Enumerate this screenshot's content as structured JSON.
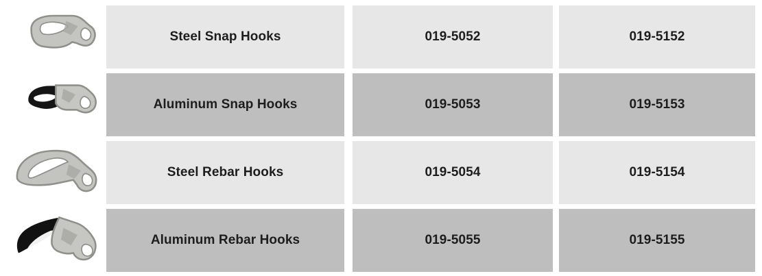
{
  "table": {
    "rows": [
      {
        "product": "Steel Snap Hooks",
        "code_a": "019-5052",
        "code_b": "019-5152",
        "image_icon": "steel-snap-hook-icon"
      },
      {
        "product": "Aluminum Snap Hooks",
        "code_a": "019-5053",
        "code_b": "019-5153",
        "image_icon": "aluminum-snap-hook-icon"
      },
      {
        "product": "Steel Rebar Hooks",
        "code_a": "019-5054",
        "code_b": "019-5154",
        "image_icon": "steel-rebar-hook-icon"
      },
      {
        "product": "Aluminum Rebar Hooks",
        "code_a": "019-5055",
        "code_b": "019-5155",
        "image_icon": "aluminum-rebar-hook-icon"
      }
    ]
  },
  "colors": {
    "light_row": "#e6e7e6",
    "dark_row": "#bdbebd",
    "text": "#1d1d1d",
    "steel_hook": "#b9bab6",
    "aluminum_hook_body": "#1a1a1a"
  }
}
